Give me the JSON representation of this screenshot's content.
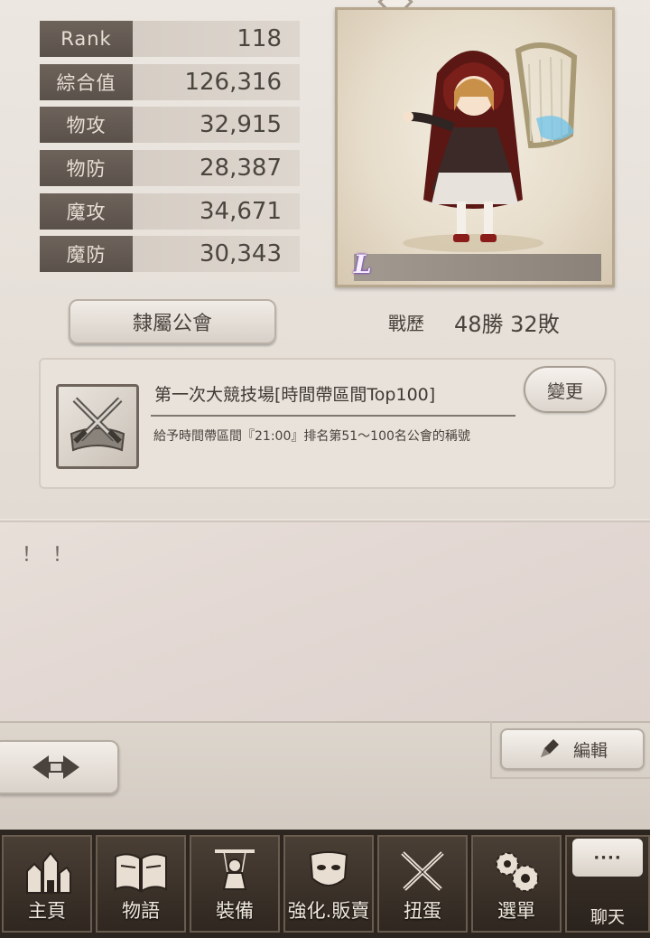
{
  "stats": [
    {
      "label": "Rank",
      "value": "118"
    },
    {
      "label": "綜合值",
      "value": "126,316"
    },
    {
      "label": "物攻",
      "value": "32,915"
    },
    {
      "label": "物防",
      "value": "28,387"
    },
    {
      "label": "魔攻",
      "value": "34,671"
    },
    {
      "label": "魔防",
      "value": "30,343"
    }
  ],
  "character": {
    "rarity": "L"
  },
  "guild_button": "隸屬公會",
  "record": {
    "label": "戰歷",
    "value": "48勝 32敗"
  },
  "title": {
    "name": "第一次大競技場[時間帶區間Top100]",
    "description": "給予時間帶區間『21:00』排名第51～100名公會的稱號",
    "change_button": "變更"
  },
  "comment": "！！",
  "edit_button": "編輯",
  "tabs": [
    {
      "label": "主頁",
      "icon": "castle-icon"
    },
    {
      "label": "物語",
      "icon": "book-icon"
    },
    {
      "label": "裝備",
      "icon": "puppet-icon"
    },
    {
      "label": "強化.販賣",
      "icon": "mask-icon"
    },
    {
      "label": "扭蛋",
      "icon": "crossed-swords-icon"
    },
    {
      "label": "選單",
      "icon": "gears-icon"
    }
  ],
  "chat": {
    "bubble": "····",
    "label": "聊天"
  }
}
